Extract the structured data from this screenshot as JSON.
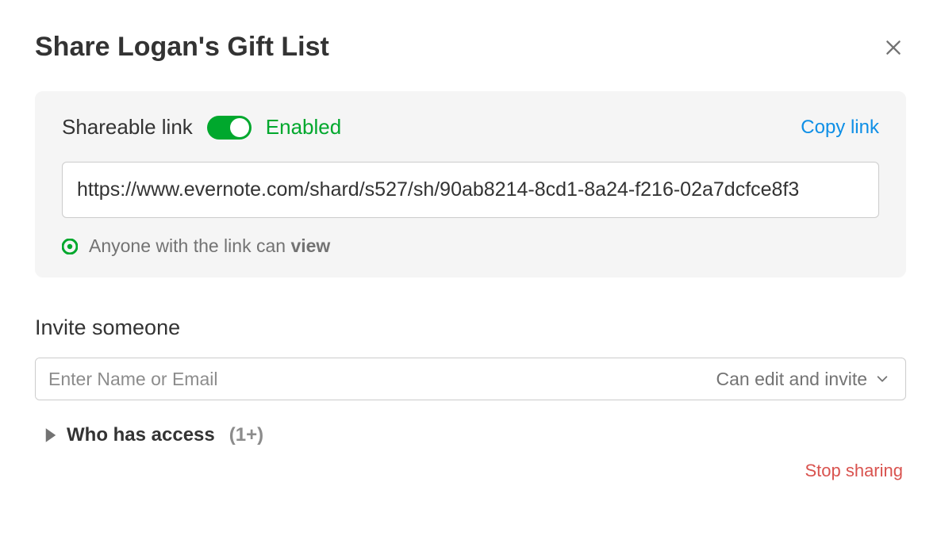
{
  "title": "Share Logan's Gift List",
  "shareBox": {
    "label": "Shareable link",
    "toggleEnabled": true,
    "enabledText": "Enabled",
    "copyLink": "Copy link",
    "url": "https://www.evernote.com/shard/s527/sh/90ab8214-8cd1-8a24-f216-02a7dcfce8f3",
    "permissionPrefix": "Anyone with the link can ",
    "permissionBold": "view"
  },
  "invite": {
    "label": "Invite someone",
    "placeholder": "Enter Name or Email",
    "permissionOption": "Can edit and invite"
  },
  "access": {
    "label": "Who has access",
    "count": "(1+)"
  },
  "stopSharing": "Stop sharing",
  "colors": {
    "accentGreen": "#00a82d",
    "linkBlue": "#0e8fe6",
    "dangerRed": "#d9534f"
  }
}
